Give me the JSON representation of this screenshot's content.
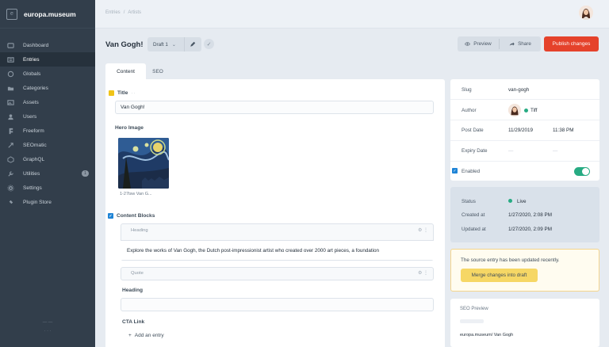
{
  "site": {
    "name": "europa.museum"
  },
  "nav": [
    {
      "label": "Dashboard",
      "icon": "dashboard-icon"
    },
    {
      "label": "Entries",
      "icon": "entries-icon",
      "active": true
    },
    {
      "label": "Globals",
      "icon": "globals-icon"
    },
    {
      "label": "Categories",
      "icon": "categories-icon"
    },
    {
      "label": "Assets",
      "icon": "assets-icon"
    },
    {
      "label": "Users",
      "icon": "users-icon"
    },
    {
      "label": "Freeform",
      "icon": "freeform-icon"
    },
    {
      "label": "SEOmatic",
      "icon": "seomatic-icon"
    },
    {
      "label": "GraphQL",
      "icon": "graphql-icon"
    },
    {
      "label": "Utilities",
      "icon": "utilities-icon",
      "badge": "1"
    },
    {
      "label": "Settings",
      "icon": "settings-icon"
    },
    {
      "label": "Plugin Store",
      "icon": "plugin-store-icon"
    }
  ],
  "breadcrumb": [
    "Entries",
    "Artists"
  ],
  "page": {
    "title": "Van Gogh!"
  },
  "draft": {
    "label": "Draft 1"
  },
  "toolbar": {
    "preview": "Preview",
    "share": "Share",
    "publish": "Publish changes"
  },
  "tabs": [
    "Content",
    "SEO"
  ],
  "fields": {
    "title_label": "Title",
    "title_value": "Van Gogh!",
    "hero_label": "Hero Image",
    "hero_caption": "1-27tsw Van G...",
    "blocks_label": "Content Blocks",
    "block1_type": "Heading",
    "block1_text": "Explore the works of Van Gogh, the Dutch post-impressionist artist who created over 2000 art pieces, a foundation",
    "block2_type": "Quote",
    "heading_label": "Heading",
    "cta_label": "CTA Link",
    "add_entry": "Add an entry"
  },
  "meta": {
    "slug_label": "Slug",
    "slug_value": "van-gogh",
    "author_label": "Author",
    "author_value": "Tiff",
    "post_date_label": "Post Date",
    "post_date_value": "11/29/2019",
    "post_time_value": "11:38 PM",
    "expiry_label": "Expiry Date",
    "enabled_label": "Enabled"
  },
  "status": {
    "status_label": "Status",
    "status_value": "Live",
    "created_label": "Created at",
    "created_value": "1/27/2020, 2:08 PM",
    "updated_label": "Updated at",
    "updated_value": "1/27/2020, 2:09 PM"
  },
  "notice": {
    "text": "The source entry has been updated recently.",
    "button": "Merge changes into draft"
  },
  "seo": {
    "title": "SEO Preview",
    "url": "europa.museum/ Van Gogh"
  },
  "colors": {
    "sidebar": "#323e4b",
    "publish": "#e5422b",
    "live": "#27ab83",
    "merge": "#f6d765"
  }
}
